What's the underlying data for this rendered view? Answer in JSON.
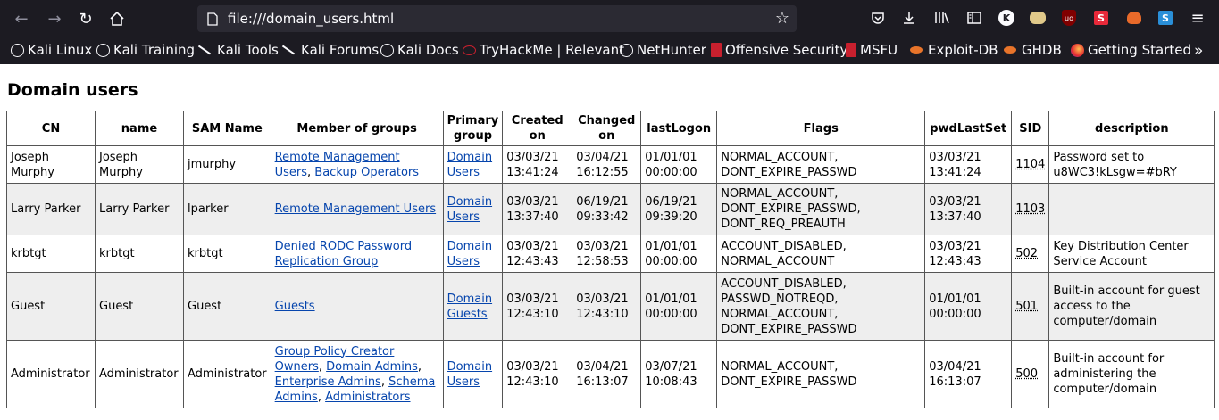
{
  "browser": {
    "url": "file:///domain_users.html",
    "bookmarks": [
      {
        "label": "Kali Linux",
        "icon": "globe-icon"
      },
      {
        "label": "Kali Training",
        "icon": "globe-icon"
      },
      {
        "label": "Kali Tools",
        "icon": "kali-dragon-icon"
      },
      {
        "label": "Kali Forums",
        "icon": "kali-dragon-icon"
      },
      {
        "label": "Kali Docs",
        "icon": "globe-icon"
      },
      {
        "label": "TryHackMe | Relevant",
        "icon": "tryhackme-icon"
      },
      {
        "label": "NetHunter",
        "icon": "globe-icon"
      },
      {
        "label": "Offensive Security",
        "icon": "offsec-icon"
      },
      {
        "label": "MSFU",
        "icon": "offsec-icon"
      },
      {
        "label": "Exploit-DB",
        "icon": "exploitdb-icon"
      },
      {
        "label": "GHDB",
        "icon": "exploitdb-icon"
      },
      {
        "label": "Getting Started",
        "icon": "firefox-icon"
      }
    ]
  },
  "page": {
    "title": "Domain users",
    "headers": {
      "cn": "CN",
      "name": "name",
      "sam": "SAM Name",
      "groups": "Member of groups",
      "primary": "Primary group",
      "created": "Created on",
      "changed": "Changed on",
      "lastlogon": "lastLogon",
      "flags": "Flags",
      "pwdlastset": "pwdLastSet",
      "sid": "SID",
      "description": "description"
    },
    "rows": [
      {
        "cn": "Joseph Murphy",
        "name": "Joseph Murphy",
        "sam": "jmurphy",
        "groups": [
          "Remote Management Users",
          "Backup Operators"
        ],
        "primary": "Domain Users",
        "created": "03/03/21 13:41:24",
        "changed": "03/04/21 16:12:55",
        "lastlogon": "01/01/01 00:00:00",
        "flags": "NORMAL_ACCOUNT, DONT_EXPIRE_PASSWD",
        "pwdlastset": "03/03/21 13:41:24",
        "sid": "1104",
        "description": "Password set to u8WC3!kLsgw=#bRY"
      },
      {
        "cn": "Larry Parker",
        "name": "Larry Parker",
        "sam": "lparker",
        "groups": [
          "Remote Management Users"
        ],
        "primary": "Domain Users",
        "created": "03/03/21 13:37:40",
        "changed": "06/19/21 09:33:42",
        "lastlogon": "06/19/21 09:39:20",
        "flags": "NORMAL_ACCOUNT, DONT_EXPIRE_PASSWD, DONT_REQ_PREAUTH",
        "pwdlastset": "03/03/21 13:37:40",
        "sid": "1103",
        "description": ""
      },
      {
        "cn": "krbtgt",
        "name": "krbtgt",
        "sam": "krbtgt",
        "groups": [
          "Denied RODC Password Replication Group"
        ],
        "primary": "Domain Users",
        "created": "03/03/21 12:43:43",
        "changed": "03/03/21 12:58:53",
        "lastlogon": "01/01/01 00:00:00",
        "flags": "ACCOUNT_DISABLED, NORMAL_ACCOUNT",
        "pwdlastset": "03/03/21 12:43:43",
        "sid": "502",
        "description": "Key Distribution Center Service Account"
      },
      {
        "cn": "Guest",
        "name": "Guest",
        "sam": "Guest",
        "groups": [
          "Guests"
        ],
        "primary": "Domain Guests",
        "created": "03/03/21 12:43:10",
        "changed": "03/03/21 12:43:10",
        "lastlogon": "01/01/01 00:00:00",
        "flags": "ACCOUNT_DISABLED, PASSWD_NOTREQD, NORMAL_ACCOUNT, DONT_EXPIRE_PASSWD",
        "pwdlastset": "01/01/01 00:00:00",
        "sid": "501",
        "description": "Built-in account for guest access to the computer/domain"
      },
      {
        "cn": "Administrator",
        "name": "Administrator",
        "sam": "Administrator",
        "groups": [
          "Group Policy Creator Owners",
          "Domain Admins",
          "Enterprise Admins",
          "Schema Admins",
          "Administrators"
        ],
        "primary": "Domain Users",
        "created": "03/03/21 12:43:10",
        "changed": "03/04/21 16:13:07",
        "lastlogon": "03/07/21 10:08:43",
        "flags": "NORMAL_ACCOUNT, DONT_EXPIRE_PASSWD",
        "pwdlastset": "03/04/21 16:13:07",
        "sid": "500",
        "description": "Built-in account for administering the computer/domain"
      }
    ]
  },
  "colors": {
    "chrome_bg": "#1c1b22",
    "urlbar_bg": "#2b2a33",
    "link": "#0645ad",
    "alt_row": "#eeeeee"
  }
}
